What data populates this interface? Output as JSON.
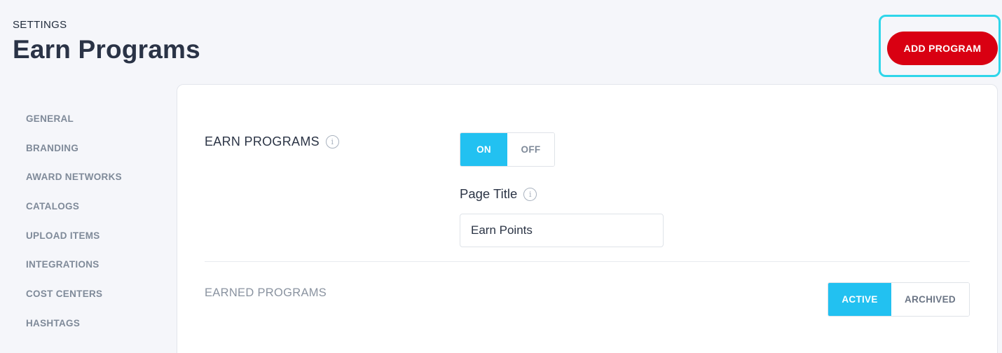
{
  "header": {
    "breadcrumb": "SETTINGS",
    "title": "Earn Programs",
    "add_button_label": "ADD PROGRAM"
  },
  "sidebar": {
    "items": [
      {
        "label": "GENERAL"
      },
      {
        "label": "BRANDING"
      },
      {
        "label": "AWARD NETWORKS"
      },
      {
        "label": "CATALOGS"
      },
      {
        "label": "UPLOAD ITEMS"
      },
      {
        "label": "INTEGRATIONS"
      },
      {
        "label": "COST CENTERS"
      },
      {
        "label": "HASHTAGS"
      }
    ]
  },
  "main": {
    "earn_programs_label": "EARN PROGRAMS",
    "toggle": {
      "on_label": "ON",
      "off_label": "OFF",
      "selected": "ON"
    },
    "page_title_label": "Page Title",
    "page_title_value": "Earn Points",
    "earned_programs_label": "EARNED PROGRAMS",
    "filter": {
      "active_label": "ACTIVE",
      "archived_label": "ARCHIVED",
      "selected": "ACTIVE"
    }
  },
  "icons": {
    "info": "info-icon"
  },
  "colors": {
    "accent": "#22c1f1",
    "primary_button": "#d90012",
    "highlight": "#2fd6ea"
  }
}
